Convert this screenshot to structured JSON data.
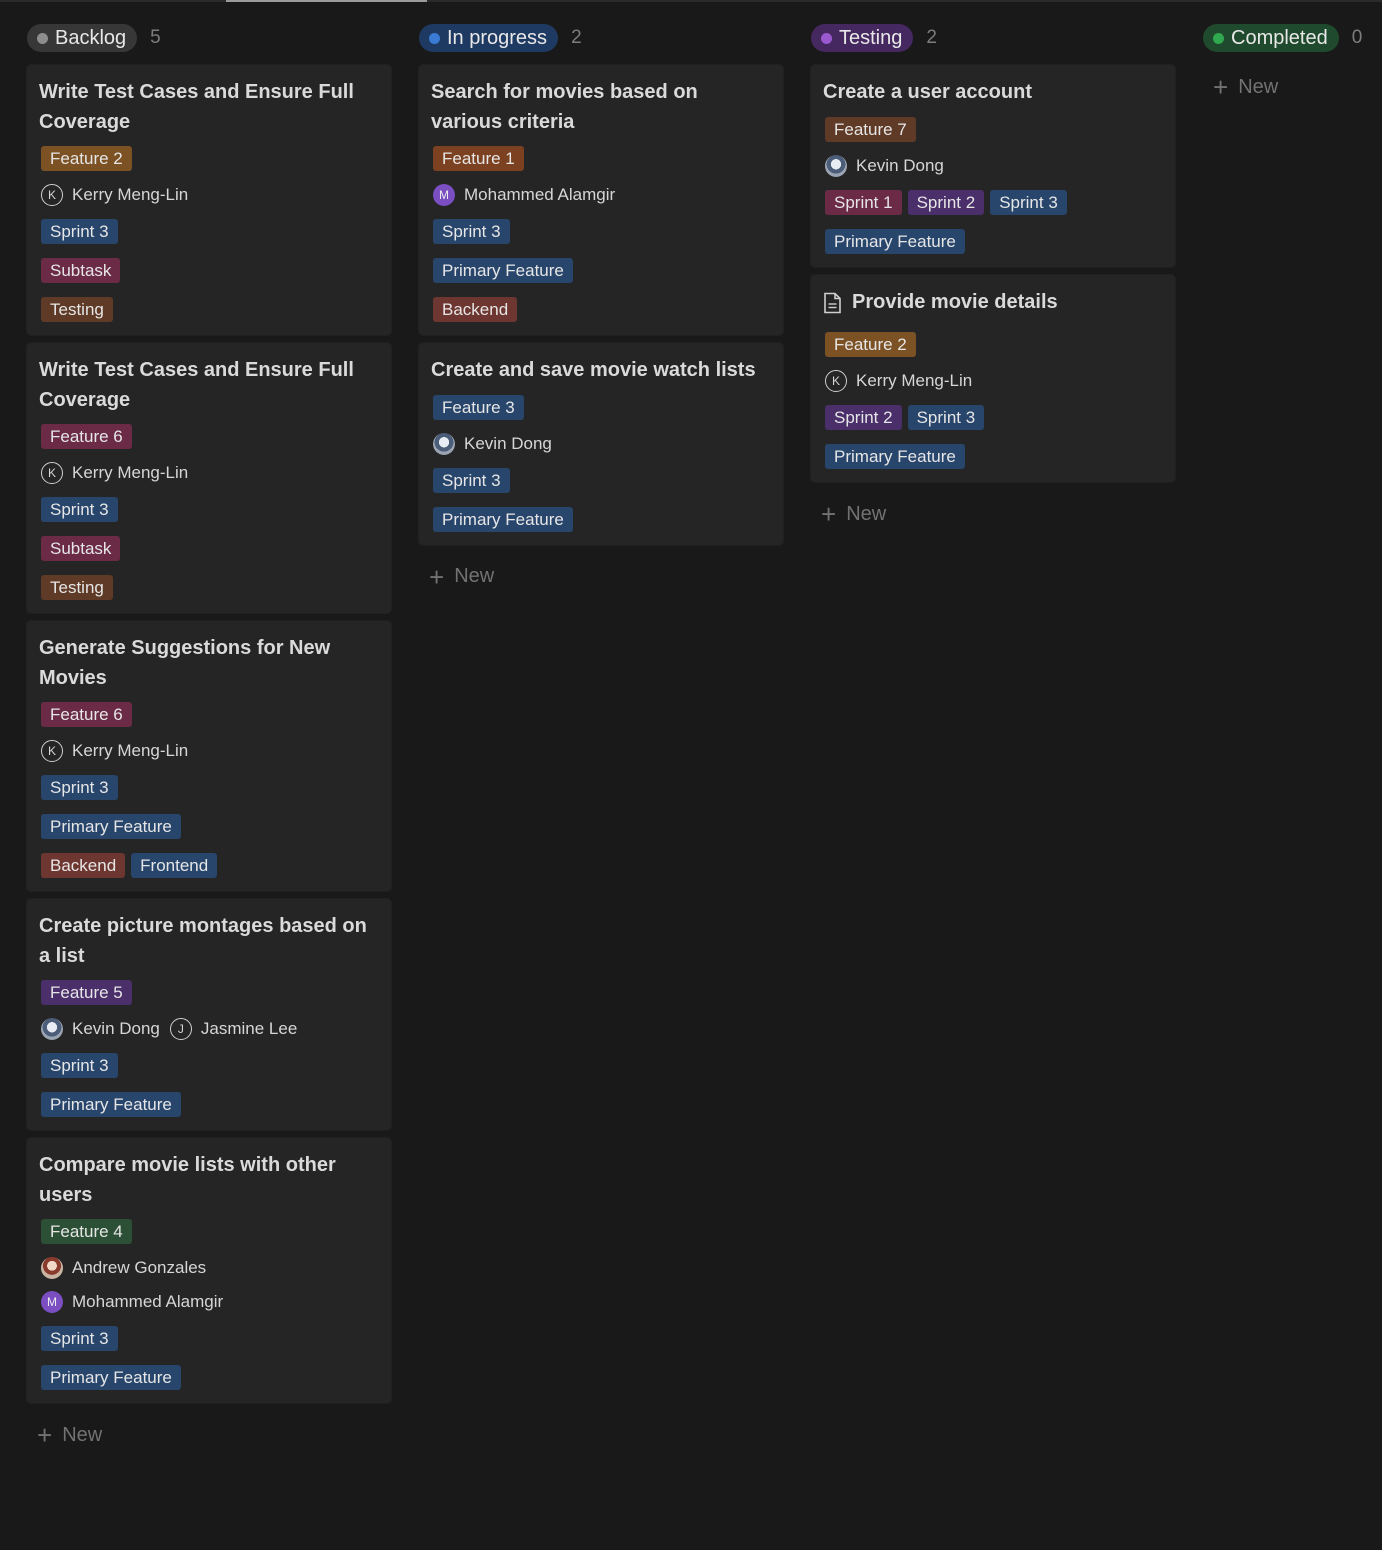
{
  "new_label": "New",
  "columns": [
    {
      "name": "Backlog",
      "count": "5",
      "color": "#8d8d8d",
      "pill_bg": "#373737",
      "cards": [
        {
          "title": "Write Test Cases and Ensure Full Coverage",
          "icon": "",
          "feature": {
            "label": "Feature 2",
            "bg": "#7c5225"
          },
          "people": [
            {
              "name": "Kerry Meng-Lin",
              "avatar": "letter",
              "letter": "K"
            }
          ],
          "rows": [
            [
              {
                "label": "Sprint 3",
                "bg": "#28456c"
              }
            ],
            [
              {
                "label": "Subtask",
                "bg": "#6b2b47"
              }
            ],
            [
              {
                "label": "Testing",
                "bg": "#5f3a27"
              }
            ]
          ]
        },
        {
          "title": "Write Test Cases and Ensure Full Coverage",
          "icon": "",
          "feature": {
            "label": "Feature 6",
            "bg": "#6b2b47"
          },
          "people": [
            {
              "name": "Kerry Meng-Lin",
              "avatar": "letter",
              "letter": "K"
            }
          ],
          "rows": [
            [
              {
                "label": "Sprint 3",
                "bg": "#28456c"
              }
            ],
            [
              {
                "label": "Subtask",
                "bg": "#6b2b47"
              }
            ],
            [
              {
                "label": "Testing",
                "bg": "#5f3a27"
              }
            ]
          ]
        },
        {
          "title": "Generate Suggestions for New Movies",
          "icon": "",
          "feature": {
            "label": "Feature 6",
            "bg": "#6b2b47"
          },
          "people": [
            {
              "name": "Kerry Meng-Lin",
              "avatar": "letter",
              "letter": "K"
            }
          ],
          "rows": [
            [
              {
                "label": "Sprint 3",
                "bg": "#28456c"
              }
            ],
            [
              {
                "label": "Primary Feature",
                "bg": "#28456c"
              }
            ],
            [
              {
                "label": "Backend",
                "bg": "#6e3630"
              },
              {
                "label": "Frontend",
                "bg": "#28456c"
              }
            ]
          ]
        },
        {
          "title": "Create picture montages based on a list",
          "icon": "",
          "feature": {
            "label": "Feature 5",
            "bg": "#4a2f6b"
          },
          "people": [
            {
              "name": "Kevin Dong",
              "avatar": "photo",
              "letter": ""
            },
            {
              "name": "Jasmine Lee",
              "avatar": "letter",
              "letter": "J"
            }
          ],
          "rows": [
            [
              {
                "label": "Sprint 3",
                "bg": "#28456c"
              }
            ],
            [
              {
                "label": "Primary Feature",
                "bg": "#28456c"
              }
            ]
          ]
        },
        {
          "title": "Compare movie lists with other users",
          "icon": "",
          "feature": {
            "label": "Feature 4",
            "bg": "#2c5035"
          },
          "people": [
            {
              "name": "Andrew Gonzales",
              "avatar": "photo2",
              "letter": ""
            },
            {
              "name": "Mohammed Alamgir",
              "avatar": "m",
              "letter": "M"
            }
          ],
          "people_stacked": true,
          "rows": [
            [
              {
                "label": "Sprint 3",
                "bg": "#28456c"
              }
            ],
            [
              {
                "label": "Primary Feature",
                "bg": "#28456c"
              }
            ]
          ]
        }
      ]
    },
    {
      "name": "In progress",
      "count": "2",
      "color": "#3a7bd5",
      "pill_bg": "#1f3a62",
      "cards": [
        {
          "title": "Search for movies based on various criteria",
          "icon": "",
          "feature": {
            "label": "Feature 1",
            "bg": "#7c4120"
          },
          "people": [
            {
              "name": "Mohammed Alamgir",
              "avatar": "m",
              "letter": "M"
            }
          ],
          "rows": [
            [
              {
                "label": "Sprint 3",
                "bg": "#28456c"
              }
            ],
            [
              {
                "label": "Primary Feature",
                "bg": "#28456c"
              }
            ],
            [
              {
                "label": "Backend",
                "bg": "#6e3630"
              }
            ]
          ]
        },
        {
          "title": "Create and save movie watch lists",
          "icon": "",
          "feature": {
            "label": "Feature 3",
            "bg": "#28456c"
          },
          "people": [
            {
              "name": "Kevin Dong",
              "avatar": "photo",
              "letter": ""
            }
          ],
          "rows": [
            [
              {
                "label": "Sprint 3",
                "bg": "#28456c"
              }
            ],
            [
              {
                "label": "Primary Feature",
                "bg": "#28456c"
              }
            ]
          ]
        }
      ]
    },
    {
      "name": "Testing",
      "count": "2",
      "color": "#9b59d0",
      "pill_bg": "#45285f",
      "cards": [
        {
          "title": "Create a user account",
          "icon": "",
          "feature": {
            "label": "Feature 7",
            "bg": "#5f3a27"
          },
          "people": [
            {
              "name": "Kevin Dong",
              "avatar": "photo",
              "letter": ""
            }
          ],
          "rows": [
            [
              {
                "label": "Sprint 1",
                "bg": "#6b2b47"
              },
              {
                "label": "Sprint 2",
                "bg": "#4a2f6b"
              },
              {
                "label": "Sprint 3",
                "bg": "#28456c"
              }
            ],
            [
              {
                "label": "Primary Feature",
                "bg": "#28456c"
              }
            ]
          ]
        },
        {
          "title": "Provide movie details",
          "icon": "document-icon",
          "feature": {
            "label": "Feature 2",
            "bg": "#7c5225"
          },
          "people": [
            {
              "name": "Kerry Meng-Lin",
              "avatar": "letter",
              "letter": "K"
            }
          ],
          "rows": [
            [
              {
                "label": "Sprint 2",
                "bg": "#4a2f6b"
              },
              {
                "label": "Sprint 3",
                "bg": "#28456c"
              }
            ],
            [
              {
                "label": "Primary Feature",
                "bg": "#28456c"
              }
            ]
          ]
        }
      ]
    },
    {
      "name": "Completed",
      "count": "0",
      "color": "#2fa84f",
      "pill_bg": "#1f4a2d",
      "cards": []
    }
  ]
}
